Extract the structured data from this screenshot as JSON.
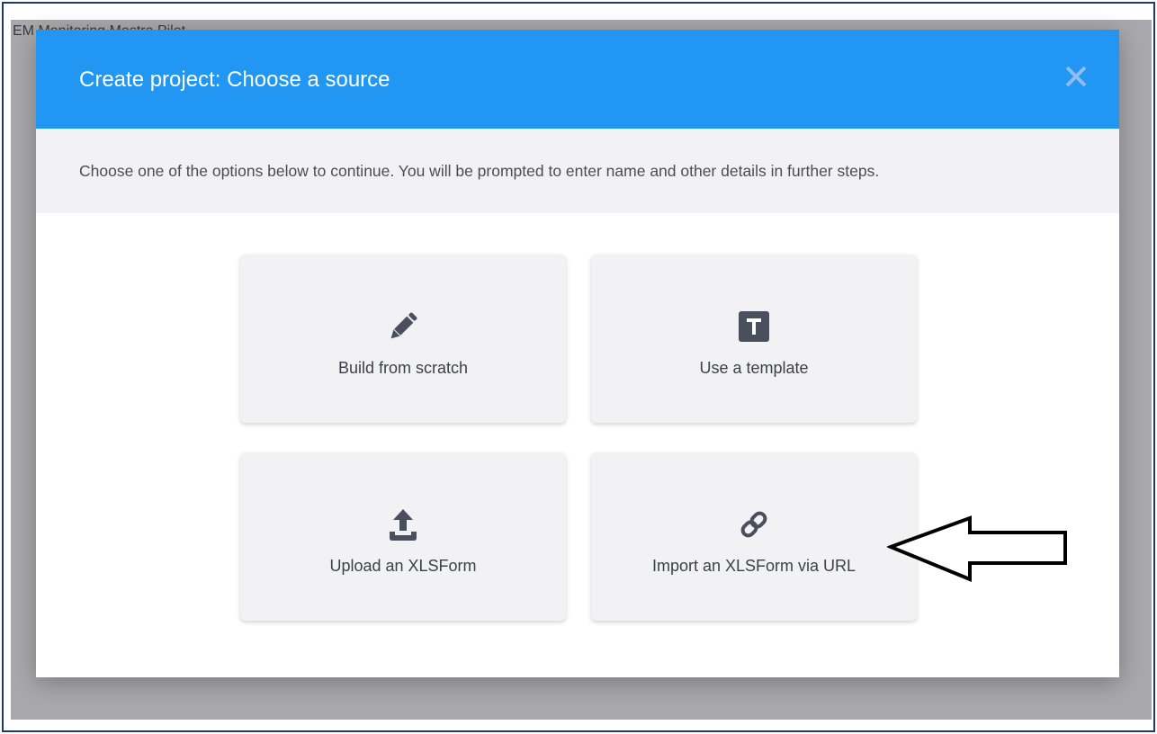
{
  "background": {
    "title_fragment": "EM Monitoring Mostra Pilot"
  },
  "modal": {
    "title": "Create project: Choose a source",
    "subtitle": "Choose one of the options below to continue. You will be prompted to enter name and other details in further steps.",
    "close_icon": "close-icon",
    "options": [
      {
        "label": "Build from scratch",
        "icon": "pencil-icon"
      },
      {
        "label": "Use a template",
        "icon": "template-icon"
      },
      {
        "label": "Upload an XLSForm",
        "icon": "upload-icon"
      },
      {
        "label": "Import an XLSForm via URL",
        "icon": "link-icon"
      }
    ]
  },
  "colors": {
    "header": "#2196f3",
    "icon": "#4a4f5e",
    "card": "#f2f2f4",
    "backdrop": "#a9a9ad"
  }
}
